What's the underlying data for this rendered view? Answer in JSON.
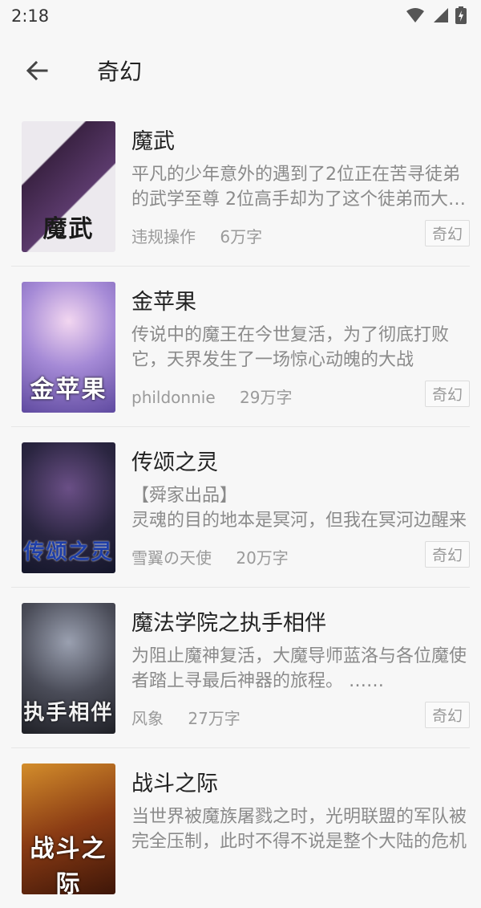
{
  "status": {
    "time": "2:18"
  },
  "header": {
    "title": "奇幻"
  },
  "books": [
    {
      "title": "魔武",
      "desc": "平凡的少年意外的遇到了2位正在苦寻徒弟的武学至尊 2位高手却为了这个徒弟而大打出手",
      "author": "违规操作",
      "words": "6万字",
      "tag": "奇幻",
      "cover_text": "魔武",
      "cover_colors": [
        "#3b2344",
        "#e9e6ea"
      ]
    },
    {
      "title": "金苹果",
      "desc": "传说中的魔王在今世复活，为了彻底打败它，天界发生了一场惊心动魄的大战",
      "author": "phildonnie",
      "words": "29万字",
      "tag": "奇幻",
      "cover_text": "金苹果",
      "cover_colors": [
        "#8e78c8",
        "#d9c6ef"
      ]
    },
    {
      "title": "传颂之灵",
      "desc": "【舜家出品】\n灵魂的目的地本是冥河，但我在冥河边醒来",
      "author": "雪翼の天使",
      "words": "20万字",
      "tag": "奇幻",
      "cover_text": "传颂之灵",
      "cover_colors": [
        "#1c1f3a",
        "#4a3c6e"
      ]
    },
    {
      "title": "魔法学院之执手相伴",
      "desc": "为阻止魔神复活，大魔导师蓝洛与各位魔使者踏上寻最后神器的旅程。 ……",
      "author": "风象",
      "words": "27万字",
      "tag": "奇幻",
      "cover_text": "执手相伴",
      "cover_colors": [
        "#2a2b31",
        "#6b6e7c"
      ]
    },
    {
      "title": "战斗之际",
      "desc": "当世界被魔族屠戮之时，光明联盟的军队被完全压制，此时不得不说是整个大陆的危机",
      "author": "",
      "words": "",
      "tag": "",
      "cover_text": "战斗之际",
      "cover_colors": [
        "#6b2d10",
        "#d18a2a"
      ]
    }
  ]
}
